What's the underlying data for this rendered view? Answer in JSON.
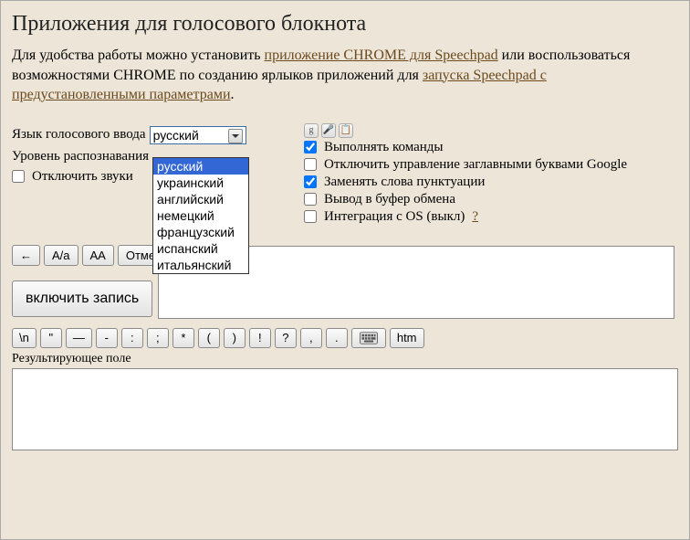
{
  "title": "Приложения для голосового блокнота",
  "intro": {
    "t1": "Для удобства работы можно установить ",
    "link1": "приложение CHROME для Speechpad",
    "t2": " или воспользоваться возможностями CHROME по созданию ярлыков приложений для ",
    "link2": "запуска Speechpad с предустановленными параметрами",
    "t3": "."
  },
  "labels": {
    "langInput": "Язык голосового ввода",
    "recogLevel": "Уровень распознавания",
    "muteSounds": "Отключить звуки"
  },
  "langSelect": {
    "value": "русский",
    "options": [
      "русский",
      "украинский",
      "английский",
      "немецкий",
      "французский",
      "испанский",
      "итальянский"
    ]
  },
  "checksLeft": {
    "mute": false
  },
  "checksRight": [
    {
      "label": "Выполнять команды",
      "checked": true
    },
    {
      "label": "Отключить управление заглавными буквами Google",
      "checked": false
    },
    {
      "label": "Заменять слова пунктуации",
      "checked": true
    },
    {
      "label": "Вывод в буфер обмена",
      "checked": false
    },
    {
      "label": "Интеграция с OS (выкл)",
      "checked": false,
      "help": "?"
    }
  ],
  "toolbar1": {
    "back": "←",
    "case1": "А/а",
    "case2": "АА",
    "undo": "Отменить"
  },
  "record": "включить запись",
  "toolbar2": [
    "\\n",
    "\"",
    "—",
    "-",
    ":",
    ";",
    "*",
    "(",
    ")",
    "!",
    "?",
    ",",
    "."
  ],
  "toolbar2_extra": {
    "kb": "keyboard",
    "htm": "htm"
  },
  "outputLabel": "Результирующее поле",
  "notesText": "",
  "outputText": ""
}
